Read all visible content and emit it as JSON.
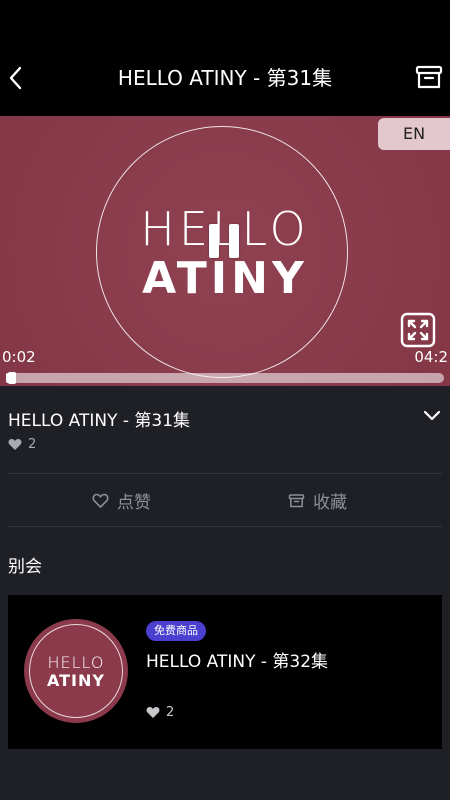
{
  "header": {
    "title": "HELLO ATINY - 第31集"
  },
  "video": {
    "language_badge": "EN",
    "logo_line1": "HELLO",
    "logo_line2": "ATINY",
    "time_current": "0:02",
    "time_total": "04:2",
    "progress_fraction": 0.01,
    "bg_color": "#8b3a4b"
  },
  "episode": {
    "title": "HELLO ATINY - 第31集",
    "likes": "2"
  },
  "actions": {
    "like_label": "点赞",
    "collect_label": "收藏"
  },
  "section": {
    "title": "别会"
  },
  "related": {
    "badge": "免费商品",
    "title": "HELLO ATINY - 第32集",
    "likes": "2",
    "thumb_line1": "HELLO",
    "thumb_line2": "ATINY"
  },
  "icons": {
    "back": "back-icon",
    "archive": "archive-icon",
    "pause": "pause-icon",
    "fullscreen": "fullscreen-icon",
    "chevron": "chevron-down-icon",
    "heart": "heart-icon",
    "box": "box-icon"
  },
  "colors": {
    "accent_badge": "#4b3fcf",
    "background": "#1f2026"
  }
}
